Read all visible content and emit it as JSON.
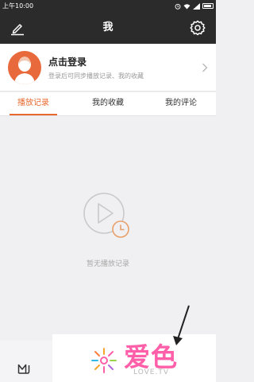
{
  "status_bar": {
    "time": "上午10:00",
    "icons": [
      "alarm-icon",
      "wifi-icon",
      "signal-icon",
      "battery-icon"
    ]
  },
  "header": {
    "title": "我",
    "left_icon": "edit-icon",
    "right_icon": "gear-icon"
  },
  "profile": {
    "title": "点击登录",
    "subtitle": "登录后可同步播放记录、我的收藏",
    "avatar_icon": "default-avatar-icon",
    "avatar_color": "#e8693b"
  },
  "tabs": [
    {
      "label": "播放记录",
      "active": true
    },
    {
      "label": "我的收藏",
      "active": false
    },
    {
      "label": "我的评论",
      "active": false
    }
  ],
  "empty_state": {
    "icon": "play-history-icon",
    "text": "暂无播放记录"
  },
  "watermark": {
    "text": "爱色",
    "subtext": "LOVE.TV",
    "logo_icon": "flower-logo-icon"
  },
  "colors": {
    "accent": "#e8692f",
    "header_bg": "#2b2b2b",
    "watermark": "#ff5fa8"
  }
}
